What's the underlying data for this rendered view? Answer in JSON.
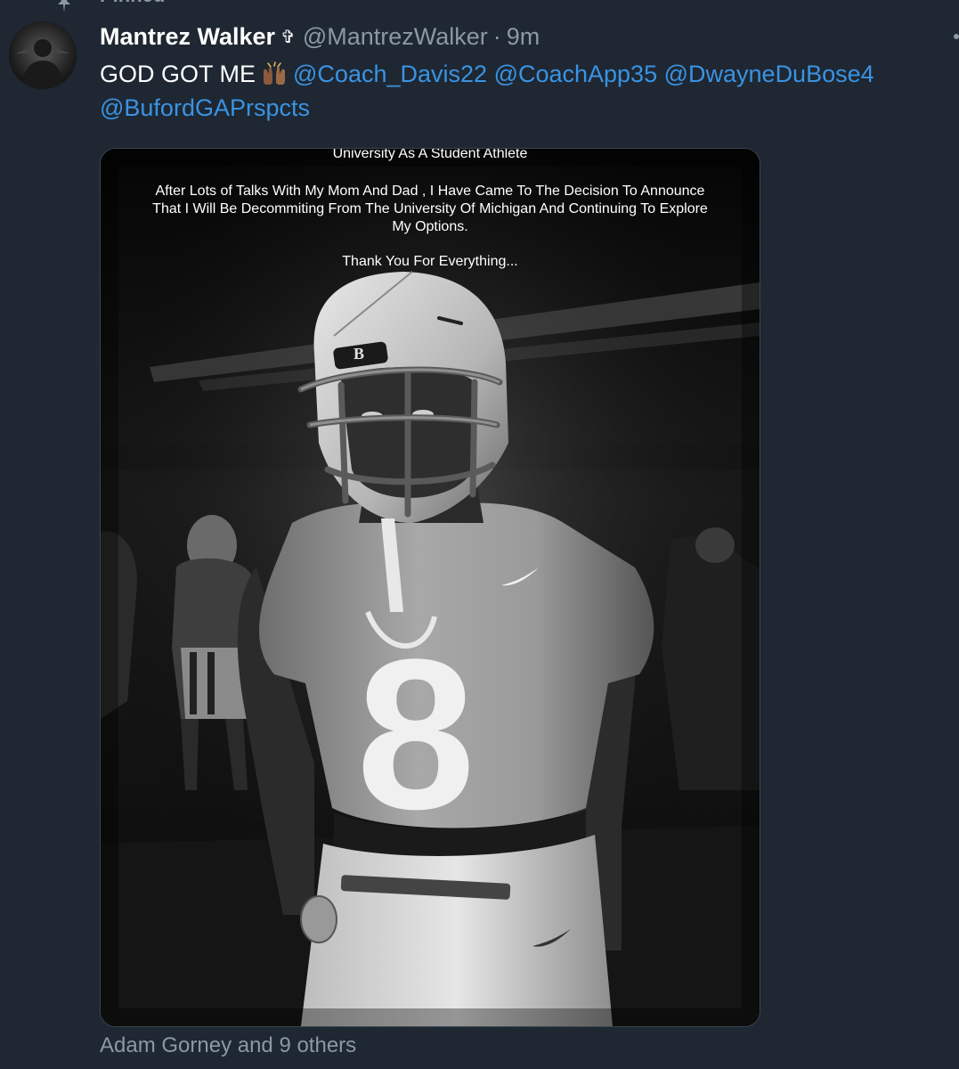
{
  "pinned": {
    "label": "Pinned",
    "icon": "pin-icon"
  },
  "tweet": {
    "author": {
      "display_name": "Mantrez Walker",
      "name_glyph": "✞",
      "handle": "@MantrezWalker",
      "separator": "·",
      "timestamp": "9m",
      "avatar_icon": "avatar-photo"
    },
    "text": {
      "prefix": "GOD GOT ME",
      "emoji": "raising-hands-emoji",
      "mentions": [
        "@Coach_Davis22",
        "@CoachApp35",
        "@DwayneDuBose4",
        "@BufordGAPrspcts"
      ]
    },
    "media": {
      "line_1": "University As A Student Athlete",
      "line_2": "After Lots of Talks With My Mom And Dad , I Have Came To The Decision To Announce",
      "line_3": "That I Will Be Decommiting From The University Of Michigan And Continuing To Explore",
      "line_4": "My Options.",
      "line_5": "Thank You For Everything...",
      "jersey_number": "8",
      "helmet_letter": "B"
    },
    "likes_text": "Adam Gorney and 9 others"
  },
  "colors": {
    "background": "#1e2732",
    "text_primary": "#ffffff",
    "text_secondary": "#8b98a5",
    "link": "#3a93e3",
    "border": "#3b4651"
  }
}
